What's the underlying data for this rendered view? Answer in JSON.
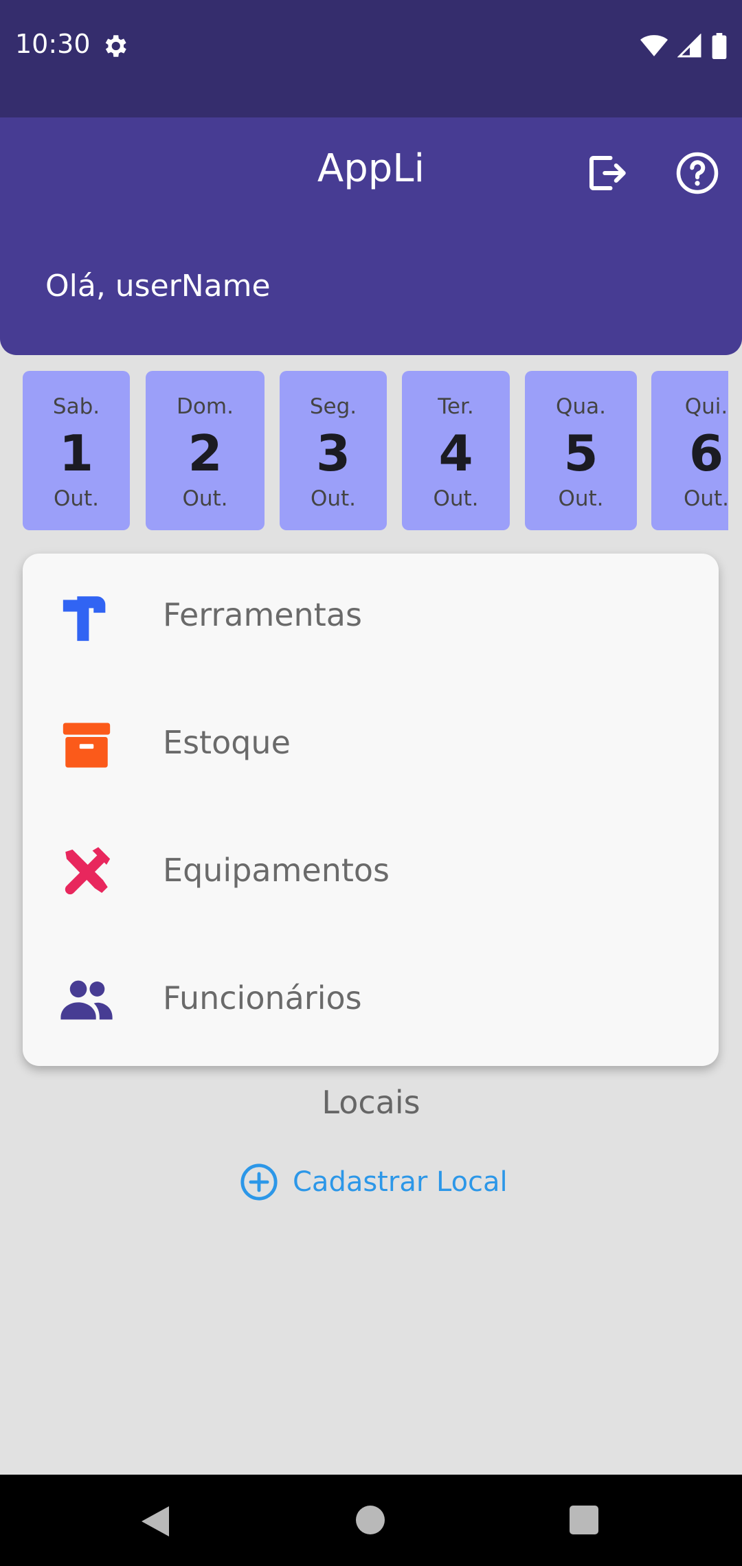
{
  "status_bar": {
    "time": "10:30"
  },
  "app_bar": {
    "title": "AppLi",
    "greeting": "Olá, userName"
  },
  "dates": [
    {
      "dow": "Sab.",
      "day": "1",
      "month": "Out."
    },
    {
      "dow": "Dom.",
      "day": "2",
      "month": "Out."
    },
    {
      "dow": "Seg.",
      "day": "3",
      "month": "Out."
    },
    {
      "dow": "Ter.",
      "day": "4",
      "month": "Out."
    },
    {
      "dow": "Qua.",
      "day": "5",
      "month": "Out."
    },
    {
      "dow": "Qui.",
      "day": "6",
      "month": "Out."
    }
  ],
  "menu": [
    {
      "label": "Ferramentas",
      "icon": "hammer-icon",
      "color": "#3164f3"
    },
    {
      "label": "Estoque",
      "icon": "archive-box-icon",
      "color": "#fb5a1a"
    },
    {
      "label": "Equipamentos",
      "icon": "tools-icon",
      "color": "#e8275d"
    },
    {
      "label": "Funcionários",
      "icon": "people-icon",
      "color": "#473c93"
    }
  ],
  "locais": {
    "title": "Locais",
    "add_label": "Cadastrar Local"
  },
  "colors": {
    "status_bar": "#352d6d",
    "app_bar": "#473c93",
    "date_card": "#9b9ff9",
    "accent_link": "#2c97e8",
    "background": "#e1e1e1"
  }
}
